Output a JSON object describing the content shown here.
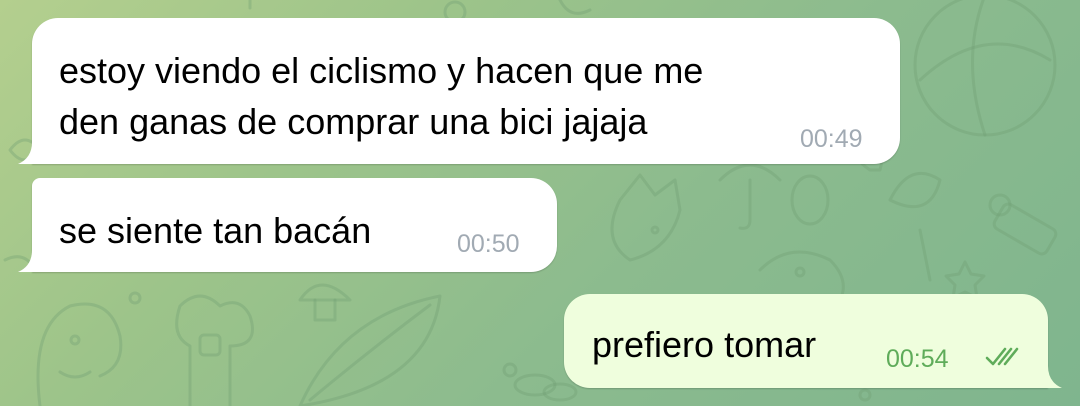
{
  "chat": {
    "messages": [
      {
        "direction": "incoming",
        "lines": [
          "estoy viendo el ciclismo y hacen que me",
          "den ganas de comprar una bici jajaja"
        ],
        "time": "00:49"
      },
      {
        "direction": "incoming",
        "lines": [
          "se siente tan bacán"
        ],
        "time": "00:50"
      },
      {
        "direction": "outgoing",
        "lines": [
          "prefiero tomar"
        ],
        "time": "00:54",
        "status_icon": "double-check-icon"
      }
    ]
  },
  "colors": {
    "incoming_bubble": "#ffffff",
    "outgoing_bubble": "#effedd",
    "incoming_time": "#a1aab3",
    "outgoing_time": "#5fac5a",
    "background": "#9dc48a"
  }
}
